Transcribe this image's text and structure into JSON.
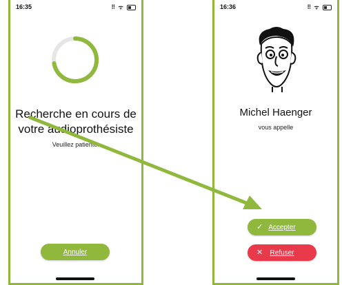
{
  "colors": {
    "accent_green": "#8fb83c",
    "decline_red": "#e83a4b"
  },
  "left_screen": {
    "status_time": "16:35",
    "status_icons": "⠿ ᯤ",
    "title": "Recherche en cours de votre audioprothésiste",
    "subtitle": "Veuillez patienter",
    "cancel_label": "Annuler"
  },
  "right_screen": {
    "status_time": "16:36",
    "status_icons": "⠿ ᯤ",
    "caller_name": "Michel Haenger",
    "subtitle": "vous appelle",
    "accept_label": "Accepter",
    "accept_icon": "check-icon",
    "decline_label": "Refuser",
    "decline_icon": "close-icon"
  }
}
